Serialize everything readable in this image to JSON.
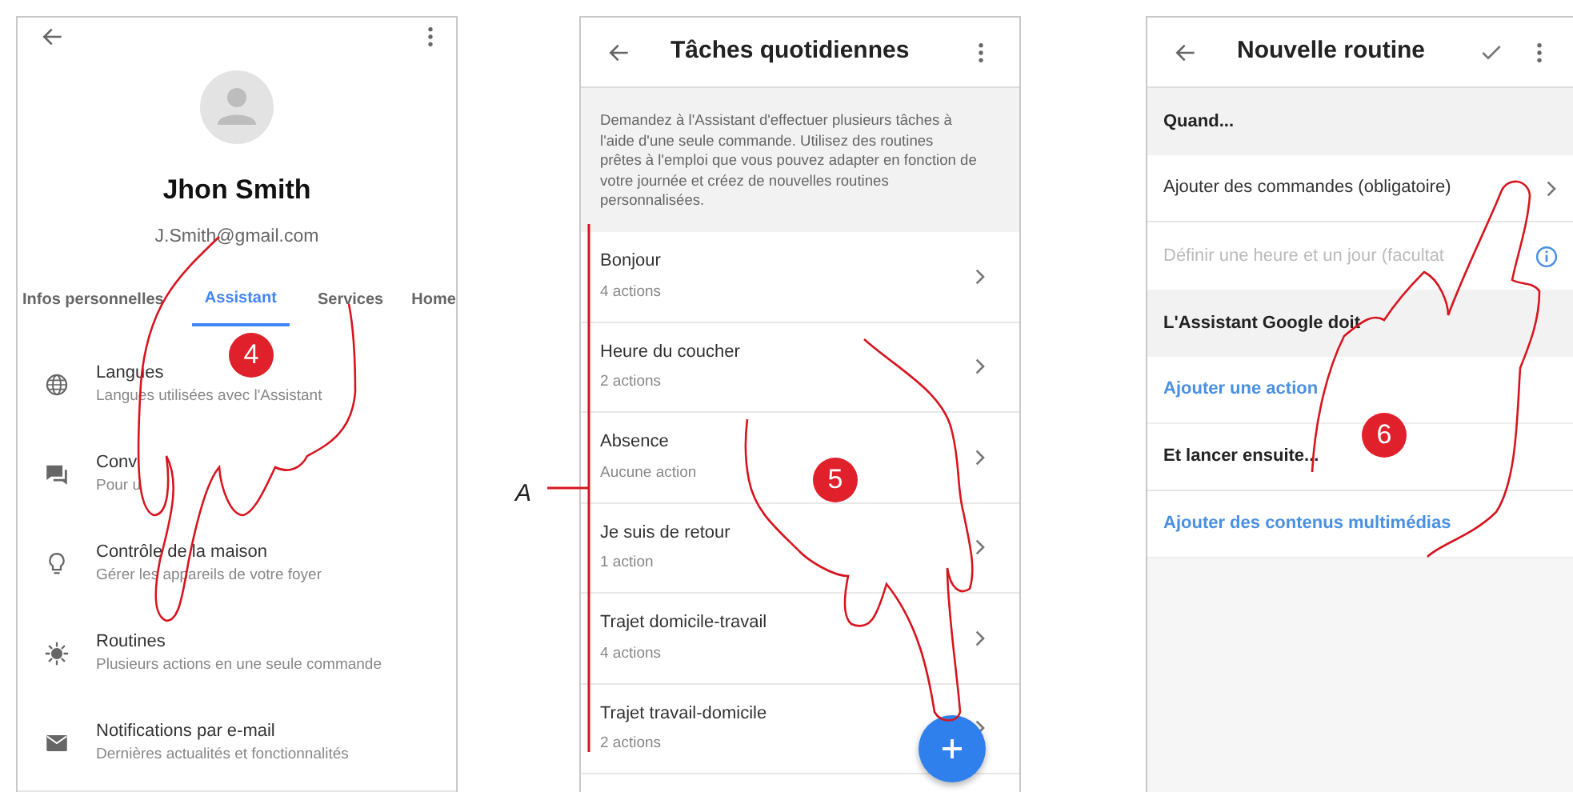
{
  "profile_screen": {
    "name": "Jhon Smith",
    "email": "J.Smith@gmail.com",
    "tabs": [
      {
        "label": "Infos personnelles",
        "selected": false
      },
      {
        "label": "Assistant",
        "selected": true
      },
      {
        "label": "Services",
        "selected": false
      },
      {
        "label": "Home",
        "selected": false
      }
    ],
    "items": [
      {
        "title": "Langues",
        "subtitle": "Langues utilisées avec l'Assistant"
      },
      {
        "title": "Conv",
        "subtitle": "Pour u"
      },
      {
        "title": "Contrôle de la maison",
        "subtitle": "Gérer les appareils de votre foyer"
      },
      {
        "title": "Routines",
        "subtitle": "Plusieurs actions en une seule commande"
      },
      {
        "title": "Notifications par e-mail",
        "subtitle": "Dernières actualités et fonctionnalités"
      }
    ]
  },
  "routines_screen": {
    "title": "Tâches quotidiennes",
    "description": "Demandez à l'Assistant d'effectuer plusieurs tâches à l'aide d'une seule commande. Utilisez des routines prêtes à l'emploi que vous pouvez adapter en fonction de votre journée et créez de nouvelles routines personnalisées.",
    "routines": [
      {
        "title": "Bonjour",
        "subtitle": "4 actions"
      },
      {
        "title": "Heure du coucher",
        "subtitle": "2 actions"
      },
      {
        "title": "Absence",
        "subtitle": "Aucune action"
      },
      {
        "title": "Je suis de retour",
        "subtitle": "1 action"
      },
      {
        "title": "Trajet domicile-travail",
        "subtitle": "4 actions"
      },
      {
        "title": "Trajet travail-domicile",
        "subtitle": "2 actions"
      }
    ]
  },
  "new_routine_screen": {
    "title": "Nouvelle routine",
    "rows": [
      {
        "kind": "section",
        "text": "Quand..."
      },
      {
        "kind": "nav",
        "text": "Ajouter des commandes (obligatoire)"
      },
      {
        "kind": "hint",
        "text": "Définir une heure et un jour (facultat"
      },
      {
        "kind": "section",
        "text": "L'Assistant Google doit"
      },
      {
        "kind": "action",
        "text": "Ajouter une action"
      },
      {
        "kind": "plain",
        "text": "Et lancer ensuite..."
      },
      {
        "kind": "action",
        "text": "Ajouter des contenus multimédias"
      }
    ]
  },
  "callouts": {
    "steps": [
      "4",
      "5",
      "6"
    ],
    "bracket_label": "A"
  }
}
